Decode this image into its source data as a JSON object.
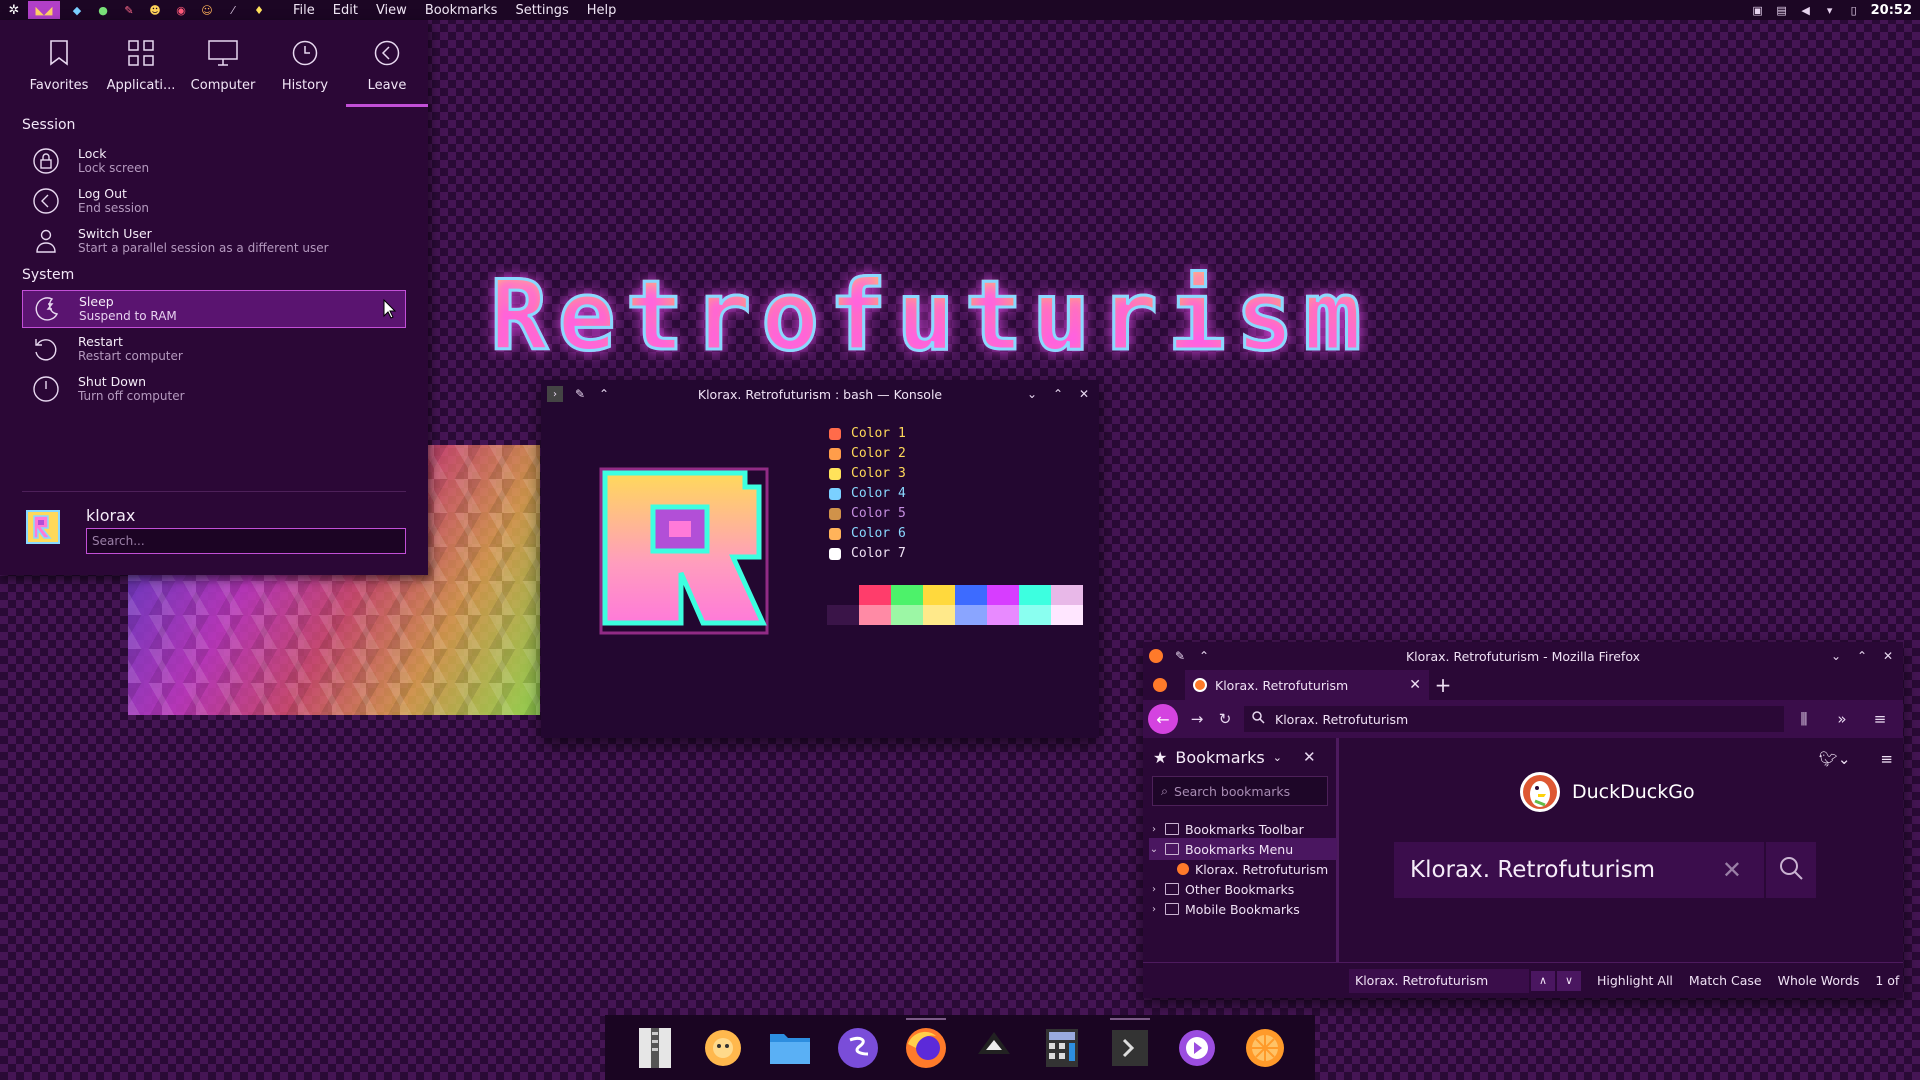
{
  "top_panel": {
    "menu": [
      "File",
      "Edit",
      "View",
      "Bookmarks",
      "Settings",
      "Help"
    ],
    "clock": "20:52"
  },
  "launcher": {
    "tabs": [
      {
        "label": "Favorites",
        "icon": "bookmark-icon"
      },
      {
        "label": "Applicati...",
        "icon": "grid-icon"
      },
      {
        "label": "Computer",
        "icon": "monitor-icon"
      },
      {
        "label": "History",
        "icon": "clock-icon"
      },
      {
        "label": "Leave",
        "icon": "leave-icon"
      }
    ],
    "active_tab": "Leave",
    "session_heading": "Session",
    "session": [
      {
        "name": "Lock",
        "desc": "Lock screen",
        "icon": "lock-icon"
      },
      {
        "name": "Log Out",
        "desc": "End session",
        "icon": "logout-icon"
      },
      {
        "name": "Switch User",
        "desc": "Start a parallel session as a different user",
        "icon": "switch-user-icon"
      }
    ],
    "system_heading": "System",
    "system": [
      {
        "name": "Sleep",
        "desc": "Suspend to RAM",
        "icon": "sleep-icon"
      },
      {
        "name": "Restart",
        "desc": "Restart computer",
        "icon": "restart-icon"
      },
      {
        "name": "Shut Down",
        "desc": "Turn off computer",
        "icon": "power-icon"
      }
    ],
    "user_name": "klorax",
    "search_placeholder": "Search..."
  },
  "wallpaper_title": "Retrofuturism",
  "konsole": {
    "title": "Klorax. Retrofuturism : bash — Konsole",
    "color_lines": [
      {
        "label": "Color 1",
        "color": "#ffd95a"
      },
      {
        "label": "Color 2",
        "color": "#ffd95a"
      },
      {
        "label": "Color 3",
        "color": "#ffd95a"
      },
      {
        "label": "Color 4",
        "color": "#8ad9ff"
      },
      {
        "label": "Color 5",
        "color": "#c58fe0"
      },
      {
        "label": "Color 6",
        "color": "#8ad9ff"
      },
      {
        "label": "Color 7",
        "color": "#f0e2f5"
      }
    ],
    "palette_top": [
      "#230730",
      "#ff3d6b",
      "#4df26a",
      "#ffd93d",
      "#3d6bff",
      "#d73dff",
      "#3dffe0",
      "#e8b8e8"
    ],
    "palette_bottom": [
      "#3a1448",
      "#ff8aa5",
      "#9cf7a5",
      "#ffe98a",
      "#8aa5ff",
      "#e88aff",
      "#8afff0",
      "#ffe6ff"
    ]
  },
  "firefox": {
    "title": "Klorax. Retrofuturism - Mozilla Firefox",
    "tab_label": "Klorax. Retrofuturism",
    "url": "Klorax. Retrofuturism",
    "sidebar": {
      "heading": "Bookmarks",
      "search_placeholder": "Search bookmarks",
      "items": [
        {
          "label": "Bookmarks Toolbar",
          "chevron": "›",
          "level": 0
        },
        {
          "label": "Bookmarks Menu",
          "chevron": "⌄",
          "level": 0
        },
        {
          "label": "Klorax. Retrofuturism",
          "chevron": "",
          "level": 1
        },
        {
          "label": "Other Bookmarks",
          "chevron": "›",
          "level": 0
        },
        {
          "label": "Mobile Bookmarks",
          "chevron": "›",
          "level": 0
        }
      ]
    },
    "ddg_name": "DuckDuckGo",
    "search_query": "Klorax. Retrofuturism",
    "findbar": {
      "value": "Klorax. Retrofuturism",
      "highlight_all": "Highlight All",
      "match_case": "Match Case",
      "whole_words": "Whole Words",
      "result": "1 of"
    }
  },
  "dock": [
    {
      "name": "archive-icon",
      "running": false
    },
    {
      "name": "flower-app-icon",
      "running": false
    },
    {
      "name": "folder-icon",
      "running": false
    },
    {
      "name": "emacs-icon",
      "running": false
    },
    {
      "name": "firefox-icon",
      "running": true
    },
    {
      "name": "inkscape-icon",
      "running": false
    },
    {
      "name": "calculator-icon",
      "running": false
    },
    {
      "name": "terminal-icon",
      "running": true
    },
    {
      "name": "media-player-icon",
      "running": false
    },
    {
      "name": "orange-app-icon",
      "running": false
    }
  ]
}
